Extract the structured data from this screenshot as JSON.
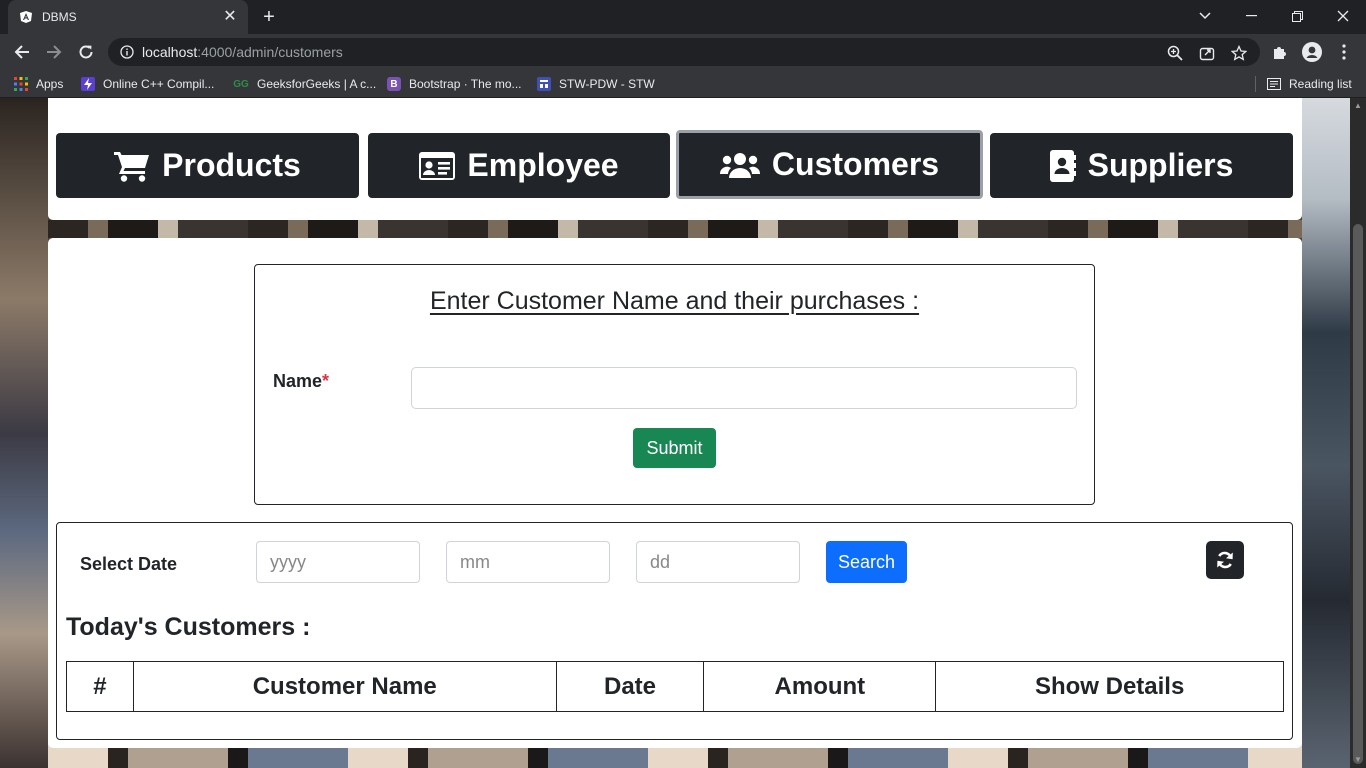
{
  "browser": {
    "tab_title": "DBMS",
    "url_host": "localhost",
    "url_rest": ":4000/admin/customers",
    "bookmarks": [
      {
        "label": "Apps",
        "icon": "apps-grid-icon"
      },
      {
        "label": "Online C++ Compil...",
        "icon": "lightning-icon"
      },
      {
        "label": "GeeksforGeeks | A c...",
        "icon": "geeksforgeeks-icon"
      },
      {
        "label": "Bootstrap · The mo...",
        "icon": "bootstrap-icon"
      },
      {
        "label": "STW-PDW - STW",
        "icon": "stw-icon"
      }
    ],
    "reading_list": "Reading list"
  },
  "nav": {
    "items": [
      {
        "label": "Products",
        "icon": "cart-icon"
      },
      {
        "label": "Employee",
        "icon": "id-card-icon"
      },
      {
        "label": "Customers",
        "icon": "users-icon",
        "active": true
      },
      {
        "label": "Suppliers",
        "icon": "address-book-icon"
      }
    ]
  },
  "form": {
    "heading": "Enter Customer Name and their purchases :",
    "name_label": "Name",
    "required_mark": "*",
    "name_value": "",
    "submit_label": "Submit"
  },
  "search": {
    "date_label": "Select Date",
    "year_placeholder": "yyyy",
    "month_placeholder": "mm",
    "day_placeholder": "dd",
    "search_label": "Search"
  },
  "table": {
    "heading": "Today's Customers :",
    "columns": [
      "#",
      "Customer Name",
      "Date",
      "Amount",
      "Show Details"
    ]
  },
  "colors": {
    "dark": "#212529",
    "submit_green": "#198754",
    "search_blue": "#0d6efd",
    "required_red": "#dc3545"
  }
}
